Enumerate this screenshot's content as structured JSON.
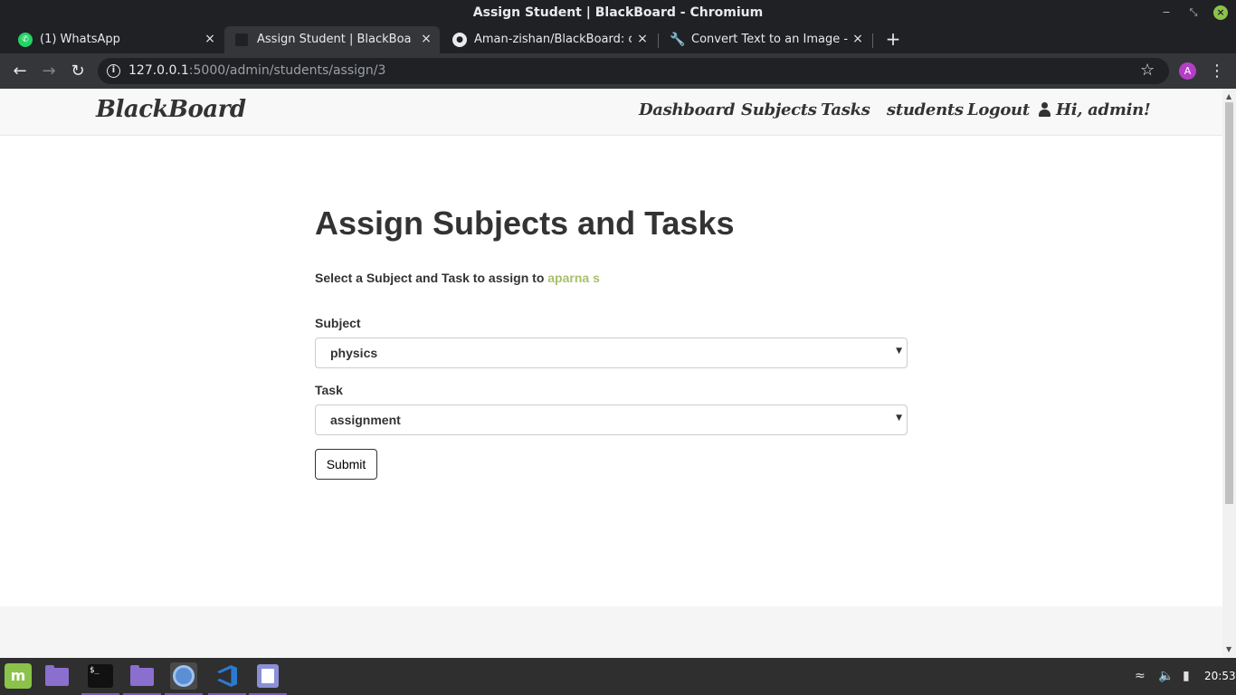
{
  "window": {
    "title": "Assign Student | BlackBoard - Chromium"
  },
  "tabs": [
    {
      "label": "(1) WhatsApp",
      "icon": "whatsapp-icon"
    },
    {
      "label": "Assign Student | BlackBoard",
      "icon": "blackboard-favicon",
      "active": true
    },
    {
      "label": "Aman-zishan/BlackBoard: class",
      "icon": "github-icon"
    },
    {
      "label": "Convert Text to an Image - Onli",
      "icon": "wrench-icon"
    }
  ],
  "toolbar": {
    "url_host": "127.0.0.1",
    "url_path": ":5000/admin/students/assign/3",
    "avatar_letter": "A"
  },
  "navbar": {
    "brand": "BlackBoard",
    "links": [
      "Dashboard",
      "Subjects",
      "Tasks",
      "students",
      "Logout"
    ],
    "user_greeting": "Hi, admin!"
  },
  "main": {
    "title": "Assign Subjects and Tasks",
    "lead_prefix": "Select a Subject and Task to assign to",
    "student_name": "aparna s",
    "subject_label": "Subject",
    "subject_value": "physics",
    "task_label": "Task",
    "task_value": "assignment",
    "submit_label": "Submit"
  },
  "taskbar": {
    "clock": "20:53"
  },
  "colors": {
    "accent_student": "#a8c06a",
    "navbar_bg": "#f8f8f8",
    "chrome_dark": "#202124",
    "chrome_toolbar": "#35363a"
  }
}
